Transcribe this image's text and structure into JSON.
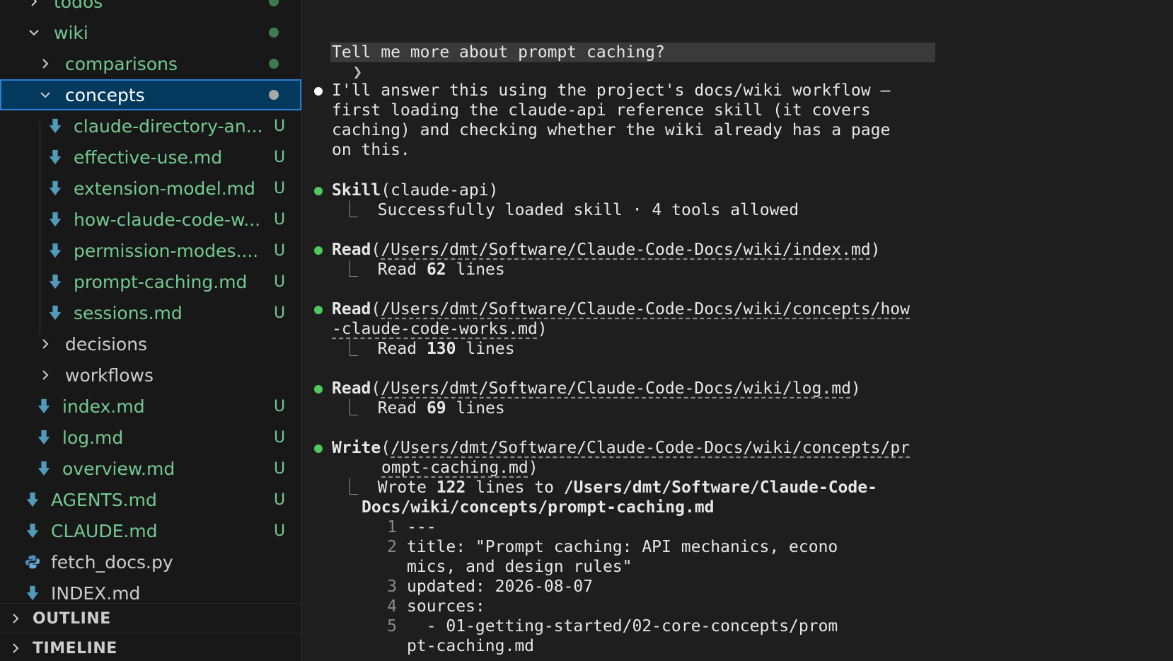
{
  "colors": {
    "git_untracked": "#73c991",
    "selection_bg": "#04395e",
    "tool_bullet": "#4ec95a"
  },
  "explorer": {
    "items": [
      {
        "name": "todos",
        "kind": "folder",
        "state": "collapsed",
        "status": "dot"
      },
      {
        "name": "wiki",
        "kind": "folder",
        "state": "expanded",
        "status": "dot"
      },
      {
        "name": "comparisons",
        "kind": "folder",
        "state": "collapsed",
        "status": "dot"
      },
      {
        "name": "concepts",
        "kind": "folder",
        "state": "expanded",
        "status": "dot",
        "selected": true
      },
      {
        "name": "claude-directory-an...",
        "kind": "markdown",
        "status": "U"
      },
      {
        "name": "effective-use.md",
        "kind": "markdown",
        "status": "U"
      },
      {
        "name": "extension-model.md",
        "kind": "markdown",
        "status": "U"
      },
      {
        "name": "how-claude-code-w...",
        "kind": "markdown",
        "status": "U"
      },
      {
        "name": "permission-modes....",
        "kind": "markdown",
        "status": "U"
      },
      {
        "name": "prompt-caching.md",
        "kind": "markdown",
        "status": "U"
      },
      {
        "name": "sessions.md",
        "kind": "markdown",
        "status": "U"
      },
      {
        "name": "decisions",
        "kind": "folder",
        "state": "collapsed",
        "status": ""
      },
      {
        "name": "workflows",
        "kind": "folder",
        "state": "collapsed",
        "status": ""
      },
      {
        "name": "index.md",
        "kind": "markdown",
        "status": "U"
      },
      {
        "name": "log.md",
        "kind": "markdown",
        "status": "U"
      },
      {
        "name": "overview.md",
        "kind": "markdown",
        "status": "U"
      },
      {
        "name": "AGENTS.md",
        "kind": "markdown",
        "status": "U"
      },
      {
        "name": "CLAUDE.md",
        "kind": "markdown",
        "status": "U"
      },
      {
        "name": "fetch_docs.py",
        "kind": "python",
        "status": ""
      },
      {
        "name": "INDEX.md",
        "kind": "markdown",
        "status": ""
      }
    ],
    "outline_label": "OUTLINE",
    "timeline_label": "TIMELINE"
  },
  "chat": {
    "prompt_marker": "❯",
    "prompt": "Tell me more about prompt caching?",
    "answer_lines": [
      "I'll answer this using the project's docs/wiki workflow —",
      "first loading the claude-api reference skill (it covers",
      "caching) and checking whether the wiki already has a page",
      "on this."
    ],
    "elbow": "⎿",
    "skill": {
      "tool": "Skill",
      "arg": "claude-api",
      "result": "Successfully loaded skill · 4 tools allowed"
    },
    "read1": {
      "tool": "Read",
      "path": "/Users/dmt/Software/Claude-Code-Docs/wiki/index.md",
      "result_pre": "Read ",
      "count": "62",
      "result_post": " lines"
    },
    "read2": {
      "tool": "Read",
      "path_line1": "/Users/dmt/Software/Claude-Code-Docs/wiki/concepts/how",
      "path_line2": "-claude-code-works.md",
      "result_pre": "Read ",
      "count": "130",
      "result_post": " lines"
    },
    "read3": {
      "tool": "Read",
      "path": "/Users/dmt/Software/Claude-Code-Docs/wiki/log.md",
      "result_pre": "Read ",
      "count": "69",
      "result_post": " lines"
    },
    "write": {
      "tool": "Write",
      "path_line1": "/Users/dmt/Software/Claude-Code-Docs/wiki/concepts/pr",
      "path_line2": "ompt-caching.md",
      "result_pre": "Wrote ",
      "count": "122",
      "result_mid": " lines to ",
      "dest_line1": "/Users/dmt/Software/Claude-Code-",
      "dest_line2": "Docs/wiki/concepts/prompt-caching.md",
      "file_lines": [
        {
          "n": "1",
          "text": "---"
        },
        {
          "n": "2",
          "text": "title: \"Prompt caching: API mechanics, econo"
        },
        {
          "n": "",
          "text": "mics, and design rules\""
        },
        {
          "n": "3",
          "text": "updated: 2026-08-07"
        },
        {
          "n": "4",
          "text": "sources:"
        },
        {
          "n": "5",
          "text": "  - 01-getting-started/02-core-concepts/prom"
        },
        {
          "n": "",
          "text": "pt-caching.md"
        }
      ]
    }
  }
}
